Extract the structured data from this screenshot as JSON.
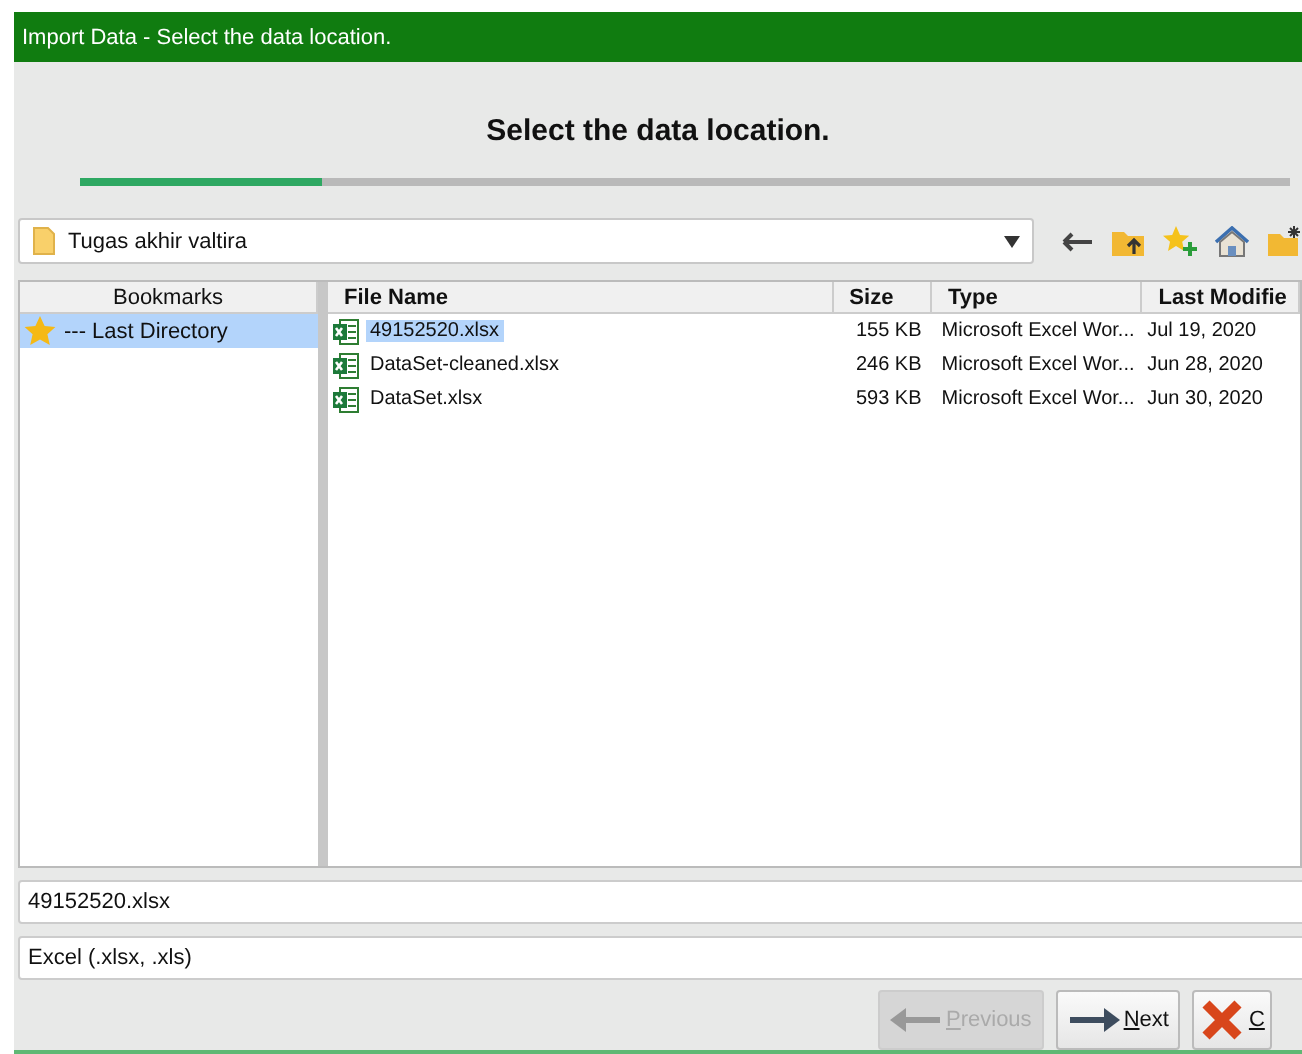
{
  "window": {
    "title": "Import Data - Select the data location."
  },
  "heading": "Select the data location.",
  "progress": {
    "level": 0.2
  },
  "location": {
    "value": "Tugas akhir valtira"
  },
  "bookmarks": {
    "header": "Bookmarks",
    "items": [
      {
        "label": "--- Last Directory",
        "selected": true
      }
    ]
  },
  "table": {
    "columns": [
      "File Name",
      "Size",
      "Type",
      "Last Modifie"
    ],
    "rows": [
      {
        "name": "49152520.xlsx",
        "size": "155 KB",
        "type": "Microsoft Excel Wor...",
        "modified": "Jul 19, 2020",
        "selected": true
      },
      {
        "name": "DataSet-cleaned.xlsx",
        "size": "246 KB",
        "type": "Microsoft Excel Wor...",
        "modified": "Jun 28, 2020",
        "selected": false
      },
      {
        "name": "DataSet.xlsx",
        "size": "593 KB",
        "type": "Microsoft Excel Wor...",
        "modified": "Jun 30, 2020",
        "selected": false
      }
    ]
  },
  "file_name": {
    "value": "49152520.xlsx"
  },
  "file_filter": {
    "value": "Excel (.xlsx, .xls)"
  },
  "buttons": [
    {
      "kind": "previous",
      "label": "Previous",
      "disabled": true
    },
    {
      "kind": "next",
      "label": "Next",
      "disabled": false
    },
    {
      "kind": "cancel",
      "label": "C",
      "disabled": false
    }
  ]
}
